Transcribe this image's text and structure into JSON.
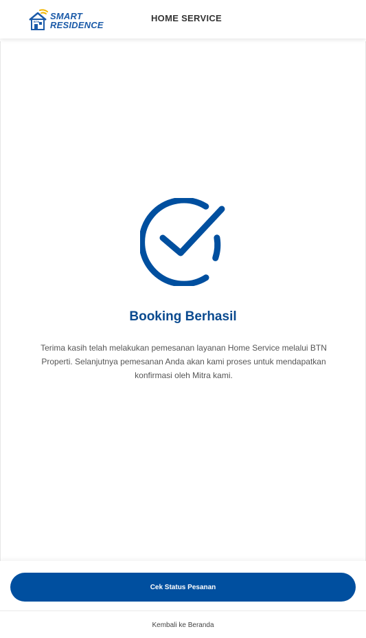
{
  "header": {
    "logo": {
      "brand_line1": "SMART",
      "brand_line2": "RESIDENCE",
      "house_label": "BTN"
    },
    "title": "HOME SERVICE"
  },
  "result": {
    "icon": "check-circle-icon",
    "title": "Booking Berhasil",
    "message": "Terima kasih telah melakukan pemesanan layanan Home Service melalui BTN Properti. Selanjutnya pemesanan Anda akan kami proses untuk mendapatkan konfirmasi oleh Mitra kami."
  },
  "footer": {
    "primary_button_label": "Cek Status Pesanan",
    "secondary_link_label": "Kembali ke Beranda"
  },
  "colors": {
    "primary": "#004f9f",
    "title": "#0a4a8f",
    "logo_blue": "#1a5aa8",
    "logo_accent": "#f2b705"
  }
}
